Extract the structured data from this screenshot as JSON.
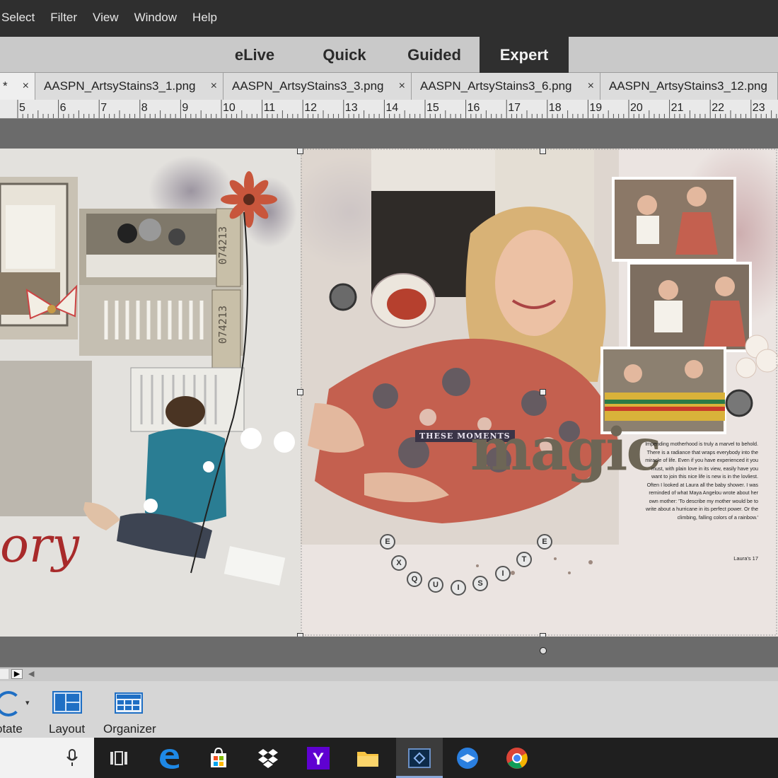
{
  "menu": [
    "Select",
    "Filter",
    "View",
    "Window",
    "Help"
  ],
  "modes": {
    "tabs": [
      "eLive",
      "Quick",
      "Guided",
      "Expert"
    ],
    "active": "Expert"
  },
  "doc_tabs": [
    {
      "label": "*",
      "active": true
    },
    {
      "label": "AASPN_ArtsyStains3_1.png",
      "active": false
    },
    {
      "label": "AASPN_ArtsyStains3_3.png",
      "active": false
    },
    {
      "label": "AASPN_ArtsyStains3_6.png",
      "active": false
    },
    {
      "label": "AASPN_ArtsyStains3_12.png",
      "active": false
    }
  ],
  "close_glyph": "×",
  "ruler": [
    "5",
    "6",
    "7",
    "8",
    "9",
    "10",
    "11",
    "12",
    "13",
    "14",
    "15",
    "16",
    "17",
    "18",
    "19",
    "20",
    "21",
    "22",
    "23"
  ],
  "canvas": {
    "left_script_text": "ory",
    "moments_label": "THESE MOMENTS",
    "magic_title": "magic",
    "exquisite_letters": [
      "E",
      "X",
      "Q",
      "U",
      "I",
      "S",
      "I",
      "T",
      "E"
    ],
    "journal_text": "Impending motherhood is truly a marvel to behold. There is a radiance that wraps everybody into the miracle of life. Even if you have experienced it you must, with plain love in its view, easily have you want to join this nice life is new is in the lovliest. Often I looked at Laura all the baby shower. I was reminded of what Maya Angelou wrote about her own mother: 'To describe my mother would be to write about a hurricane in its perfect power. Or the climbing, falling colors of a rainbow.'",
    "journal_credit": "Laura's 17",
    "tag_numbers": [
      "074213",
      "074213"
    ]
  },
  "bottom_buttons": [
    "otate",
    "Layout",
    "Organizer"
  ],
  "taskbar_icons": [
    "microphone-icon",
    "task-view-icon",
    "edge-icon",
    "store-icon",
    "dropbox-icon",
    "yahoo-icon",
    "file-explorer-icon",
    "photoshop-elements-icon",
    "thunderbird-icon",
    "chrome-icon"
  ],
  "colors": {
    "menubar": "#2f2f2f",
    "active_mode": "#2f2f2f",
    "script_red": "#a82a2a"
  }
}
